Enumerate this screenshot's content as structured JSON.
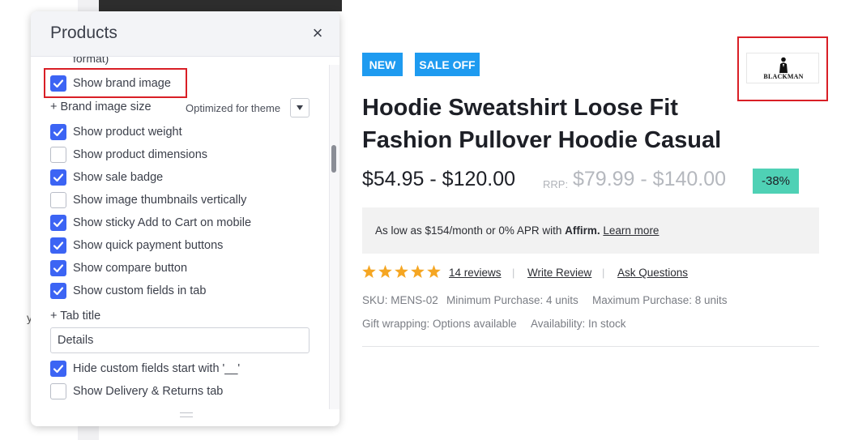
{
  "panel": {
    "title": "Products",
    "close_glyph": "×",
    "cut_off_text": "format)",
    "options": [
      {
        "label": "Show brand image",
        "checked": true
      },
      {
        "label": "Show product weight",
        "checked": true
      },
      {
        "label": "Show product dimensions",
        "checked": false
      },
      {
        "label": "Show sale badge",
        "checked": true
      },
      {
        "label": "Show image thumbnails vertically",
        "checked": false
      },
      {
        "label": "Show sticky Add to Cart on mobile",
        "checked": true
      },
      {
        "label": "Show quick payment buttons",
        "checked": true
      },
      {
        "label": "Show compare button",
        "checked": true
      },
      {
        "label": "Show custom fields in tab",
        "checked": true
      },
      {
        "label": "Hide custom fields start with '__'",
        "checked": true
      },
      {
        "label": "Show Delivery & Returns tab",
        "checked": false
      }
    ],
    "brand_image_size": {
      "label": "+ Brand image size",
      "value": "Optimized for theme"
    },
    "tab_title": {
      "label": "+ Tab title",
      "value": "Details"
    }
  },
  "background": {
    "stray_text": "y"
  },
  "product": {
    "badges": {
      "new": "NEW",
      "sale": "SALE OFF"
    },
    "brand": "BLACKMAN",
    "title_line1": "Hoodie Sweatshirt Loose Fit",
    "title_line2": "Fashion Pullover Hoodie Casual",
    "price": "$54.95 - $120.00",
    "rrp_label": "RRP:",
    "rrp_value": "$79.99 - $140.00",
    "discount": "-38%",
    "affirm": {
      "prefix": "As low as $154/month or 0% APR with",
      "brand": "Affirm.",
      "link": "Learn more"
    },
    "rating": 5,
    "reviews": "14 reviews",
    "write_review": "Write Review",
    "ask_questions": "Ask Questions",
    "sku": "SKU: MENS-02",
    "min_purchase": "Minimum Purchase: 4 units",
    "max_purchase": "Maximum Purchase: 8 units",
    "gift_wrapping": "Gift wrapping: Options available",
    "availability": "Availability: In stock"
  },
  "colors": {
    "accent": "#3c64f4",
    "badge_blue": "#1e9bf0",
    "discount_green": "#4fd1b5",
    "star": "#f5a623",
    "highlight": "#d91f26"
  }
}
